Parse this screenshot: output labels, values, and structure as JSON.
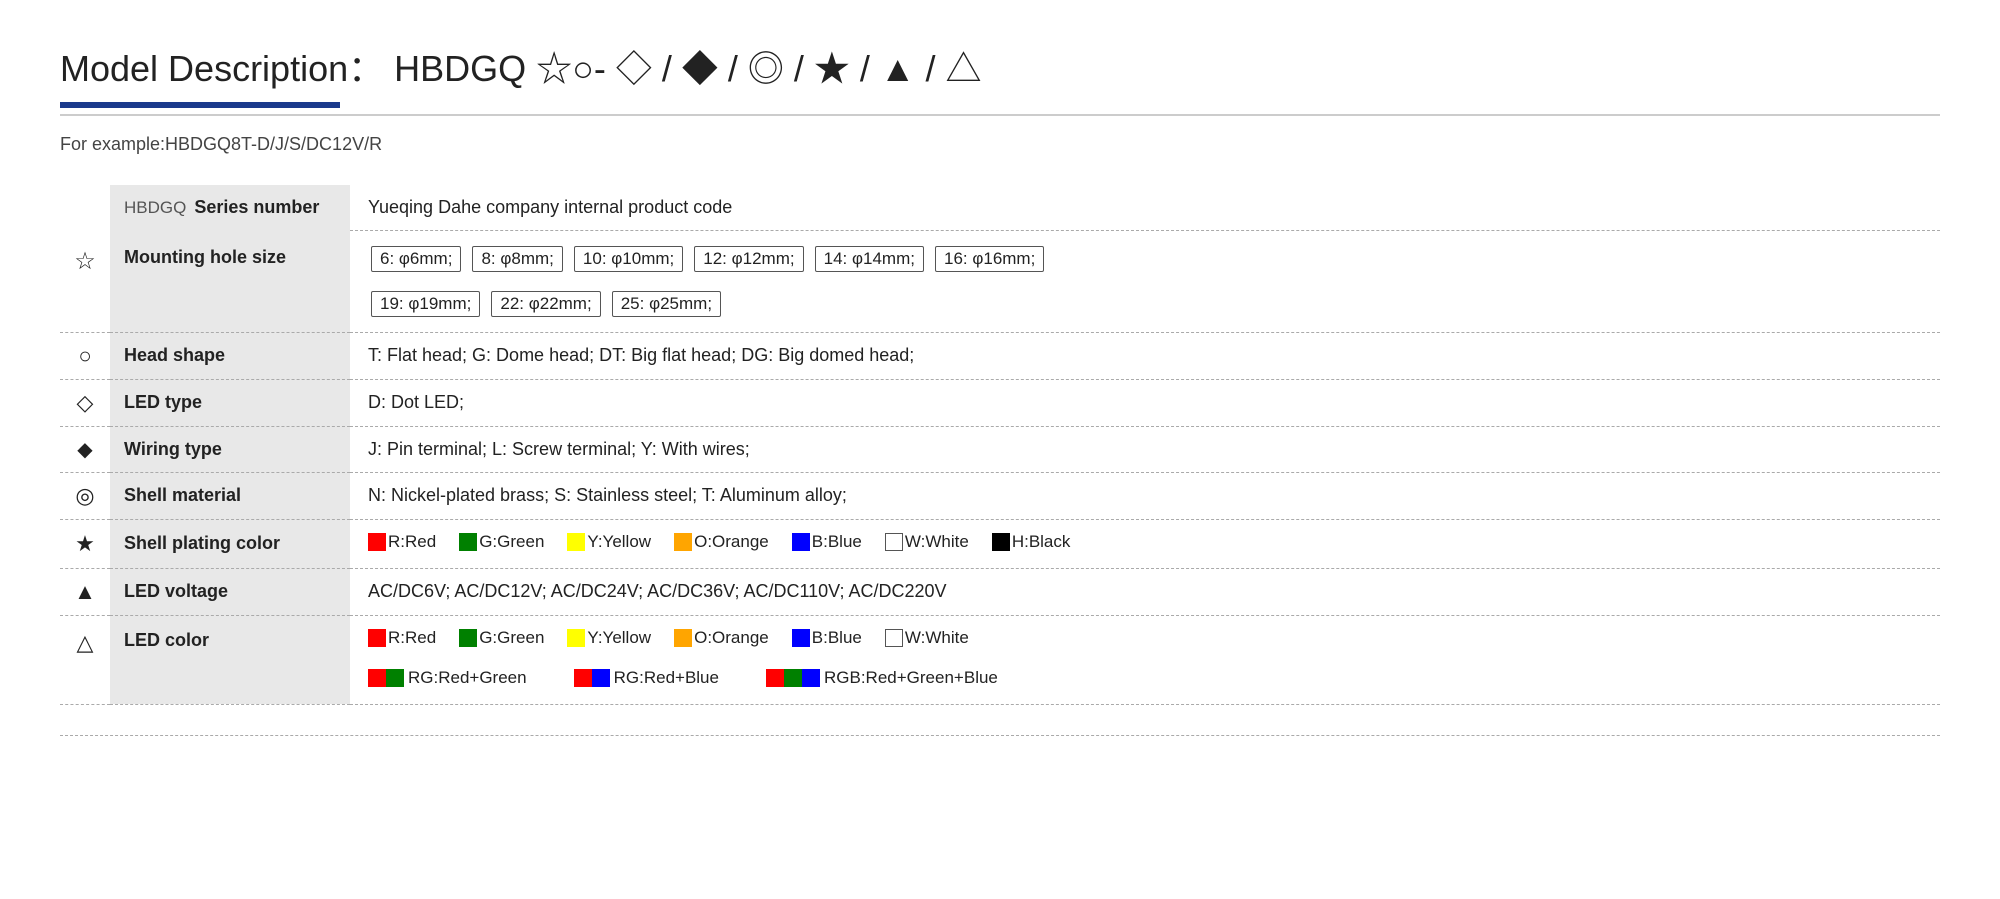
{
  "title": "Model Description： HBDGQ ☆○- ◇ / ◆ / ◎ / ★ / ▲ / △",
  "example": "For example:HBDGQ8T-D/J/S/DC12V/R",
  "table": {
    "series": {
      "prefix": "HBDGQ",
      "label": "Series number",
      "value": "Yueqing Dahe company internal product code"
    },
    "mounting_hole": {
      "icon": "☆",
      "label": "Mounting hole size",
      "badges": [
        "6: φ6mm;",
        "8: φ8mm;",
        "10: φ10mm;",
        "12: φ12mm;",
        "14: φ14mm;",
        "16: φ16mm;",
        "19: φ19mm;",
        "22: φ22mm;",
        "25: φ25mm;"
      ]
    },
    "head_shape": {
      "icon": "○",
      "label": "Head shape",
      "value": "T: Flat head;   G: Dome head;   DT: Big flat head;   DG: Big domed head;"
    },
    "led_type": {
      "icon": "◇",
      "label": "LED type",
      "value": "D: Dot LED;"
    },
    "wiring_type": {
      "icon": "◆",
      "label": "Wiring type",
      "value": "J: Pin terminal;   L: Screw terminal;   Y: With wires;"
    },
    "shell_material": {
      "icon": "◎",
      "label": "Shell material",
      "value": "N: Nickel-plated brass;   S: Stainless steel;   T: Aluminum alloy;"
    },
    "shell_plating_color": {
      "icon": "★",
      "label": "Shell plating color",
      "colors": [
        {
          "swatch": "red",
          "label": "R:Red",
          "outline": false
        },
        {
          "swatch": "green",
          "label": "G:Green",
          "outline": false
        },
        {
          "swatch": "yellow",
          "label": "Y:Yellow",
          "outline": false
        },
        {
          "swatch": "orange",
          "label": "O:Orange",
          "outline": false
        },
        {
          "swatch": "blue",
          "label": "B:Blue",
          "outline": false
        },
        {
          "swatch": "white",
          "label": "W:White",
          "outline": true
        },
        {
          "swatch": "black",
          "label": "H:Black",
          "outline": false
        }
      ]
    },
    "led_voltage": {
      "icon": "▲",
      "label": "LED voltage",
      "value": "AC/DC6V;   AC/DC12V;   AC/DC24V;   AC/DC36V;   AC/DC110V;   AC/DC220V"
    },
    "led_color": {
      "icon": "△",
      "label": "LED color",
      "colors_row1": [
        {
          "swatch": "red",
          "label": "R:Red",
          "outline": false
        },
        {
          "swatch": "green",
          "label": "G:Green",
          "outline": false
        },
        {
          "swatch": "yellow",
          "label": "Y:Yellow",
          "outline": false
        },
        {
          "swatch": "orange",
          "label": "O:Orange",
          "outline": false
        },
        {
          "swatch": "blue",
          "label": "B:Blue",
          "outline": false
        },
        {
          "swatch": "white",
          "label": "W:White",
          "outline": true
        }
      ],
      "colors_row2": [
        {
          "swatches": [
            "red",
            "green"
          ],
          "label": "RG:Red+Green"
        },
        {
          "swatches": [
            "red",
            "blue"
          ],
          "label": "RG:Red+Blue"
        },
        {
          "swatches": [
            "red",
            "green",
            "blue"
          ],
          "label": "RGB:Red+Green+Blue"
        }
      ]
    }
  }
}
